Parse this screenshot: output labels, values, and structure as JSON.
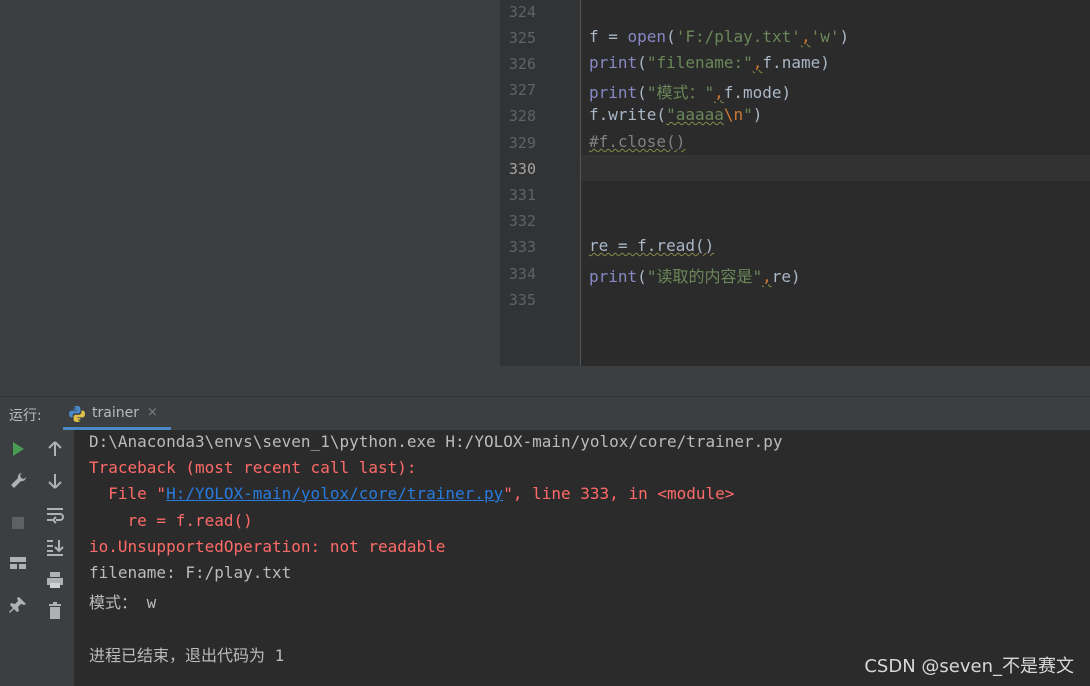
{
  "editor": {
    "current_line": "330",
    "lines": [
      {
        "num": "324"
      },
      {
        "num": "325",
        "t1": "f = ",
        "fn": "open",
        "t2": "(",
        "s1": "'F:/play.txt'",
        "c": ",",
        "s2": "'w'",
        "t3": ")"
      },
      {
        "num": "326",
        "fn": "print",
        "t1": "(",
        "s1": "\"filename:\"",
        "c": ",",
        "t2": "f.name)"
      },
      {
        "num": "327",
        "fn": "print",
        "t1": "(",
        "s1": "\"模式：\"",
        "c": ",",
        "t2": "f.mode)"
      },
      {
        "num": "328",
        "t1": "f.write(",
        "s1": "\"aaaaa",
        "esc": "\\n",
        "s2": "\"",
        "t2": ")"
      },
      {
        "num": "329",
        "comment": "#f.close()"
      },
      {
        "num": "330"
      },
      {
        "num": "331"
      },
      {
        "num": "332"
      },
      {
        "num": "333",
        "t1": "re = f.read()"
      },
      {
        "num": "334",
        "fn": "print",
        "t1": "(",
        "s1": "\"读取的内容是\"",
        "c": ",",
        "t2": "re)"
      },
      {
        "num": "335"
      }
    ]
  },
  "run_panel": {
    "label": "运行:",
    "tab_name": "trainer",
    "tab_close": "×"
  },
  "console": {
    "cmd": "D:\\Anaconda3\\envs\\seven_1\\python.exe H:/YOLOX-main/yolox/core/trainer.py",
    "traceback": "Traceback (most recent call last):",
    "file_prefix": "  File \"",
    "file_link": "H:/YOLOX-main/yolox/core/trainer.py",
    "file_suffix": "\", line 333, in <module>",
    "code_line": "    re = f.read()",
    "error": "io.UnsupportedOperation: not readable",
    "out1": "filename: F:/play.txt",
    "out2": "模式： w",
    "exit": "进程已结束，退出代码为 1"
  },
  "watermark": "CSDN @seven_不是赛文",
  "icons": [
    "run-icon",
    "wrench-icon",
    "stop-icon",
    "layout-icon",
    "pin-icon",
    "up-arrow-icon",
    "down-arrow-icon",
    "soft-wrap-icon",
    "scroll-to-end-icon",
    "print-icon",
    "trash-icon",
    "python-icon",
    "close-icon"
  ]
}
